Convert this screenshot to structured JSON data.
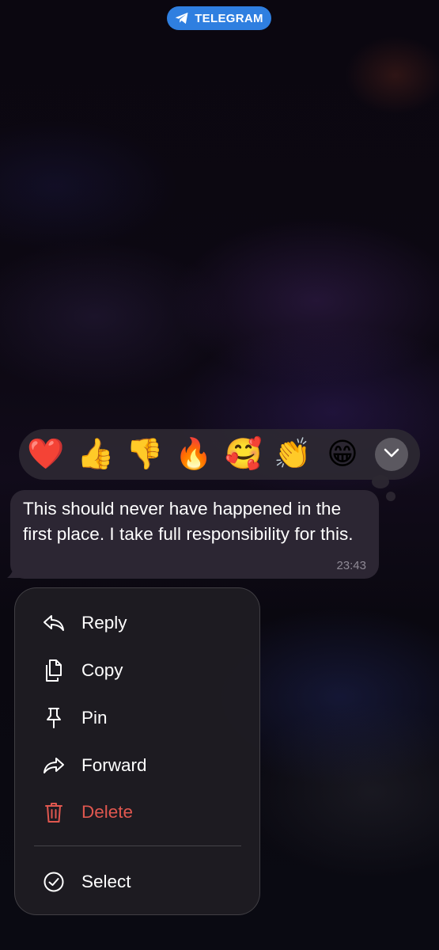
{
  "app_badge": {
    "label": "TELEGRAM",
    "icon": "telegram-plane-icon",
    "color": "#2f7fe0"
  },
  "reactions": [
    {
      "emoji": "❤️",
      "name": "red-heart"
    },
    {
      "emoji": "👍",
      "name": "thumbs-up"
    },
    {
      "emoji": "👎",
      "name": "thumbs-down"
    },
    {
      "emoji": "🔥",
      "name": "fire"
    },
    {
      "emoji": "🥰",
      "name": "smiling-face-with-hearts"
    },
    {
      "emoji": "👏",
      "name": "clapping-hands"
    },
    {
      "emoji": "😁",
      "name": "beaming-face"
    }
  ],
  "reactions_expand_icon": "chevron-down-icon",
  "message": {
    "text": "This should never have happened in the first place. I take full responsibility for this.",
    "time": "23:43"
  },
  "menu": {
    "items": [
      {
        "label": "Reply",
        "icon": "reply-icon"
      },
      {
        "label": "Copy",
        "icon": "copy-icon"
      },
      {
        "label": "Pin",
        "icon": "pin-icon"
      },
      {
        "label": "Forward",
        "icon": "forward-icon"
      },
      {
        "label": "Delete",
        "icon": "trash-icon",
        "color": "#e0574f"
      },
      {
        "label": "Select",
        "icon": "check-circle-icon"
      }
    ]
  }
}
